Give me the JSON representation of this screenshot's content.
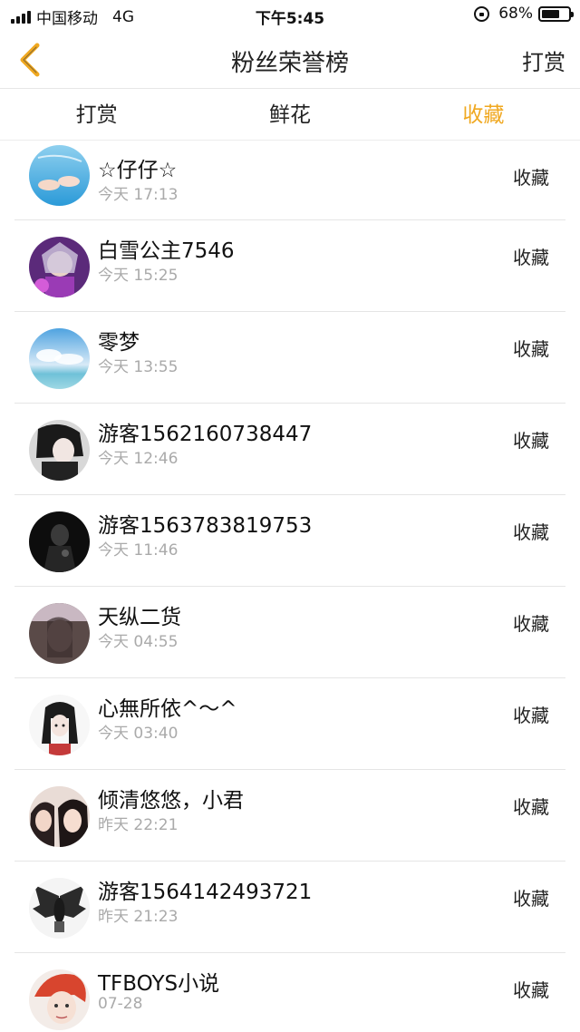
{
  "status_bar": {
    "carrier": "中国移动",
    "network": "4G",
    "time": "下午5:45",
    "battery_percent": "68%",
    "battery_level": 0.68
  },
  "nav": {
    "title": "粉丝荣誉榜",
    "action": "打赏",
    "back_icon": "chevron-left-icon",
    "accent_color": "#f0a820"
  },
  "tabs": [
    {
      "label": "打赏",
      "active": false
    },
    {
      "label": "鲜花",
      "active": false
    },
    {
      "label": "收藏",
      "active": true
    }
  ],
  "fans": [
    {
      "name": "☆仔仔☆",
      "time": "今天 17:13",
      "action": "收藏"
    },
    {
      "name": "白雪公主7546",
      "time": "今天 15:25",
      "action": "收藏"
    },
    {
      "name": "零梦",
      "time": "今天 13:55",
      "action": "收藏"
    },
    {
      "name": "游客1562160738447",
      "time": "今天 12:46",
      "action": "收藏"
    },
    {
      "name": "游客1563783819753",
      "time": "今天 11:46",
      "action": "收藏"
    },
    {
      "name": "天纵二货",
      "time": "今天 04:55",
      "action": "收藏"
    },
    {
      "name": "心無所依^～^",
      "time": "今天 03:40",
      "action": "收藏"
    },
    {
      "name": "倾清悠悠，小君",
      "time": "昨天 22:21",
      "action": "收藏"
    },
    {
      "name": "游客1564142493721",
      "time": "昨天 21:23",
      "action": "收藏"
    },
    {
      "name": "TFBOYS小说",
      "time": "07-28",
      "action": "收藏"
    }
  ]
}
